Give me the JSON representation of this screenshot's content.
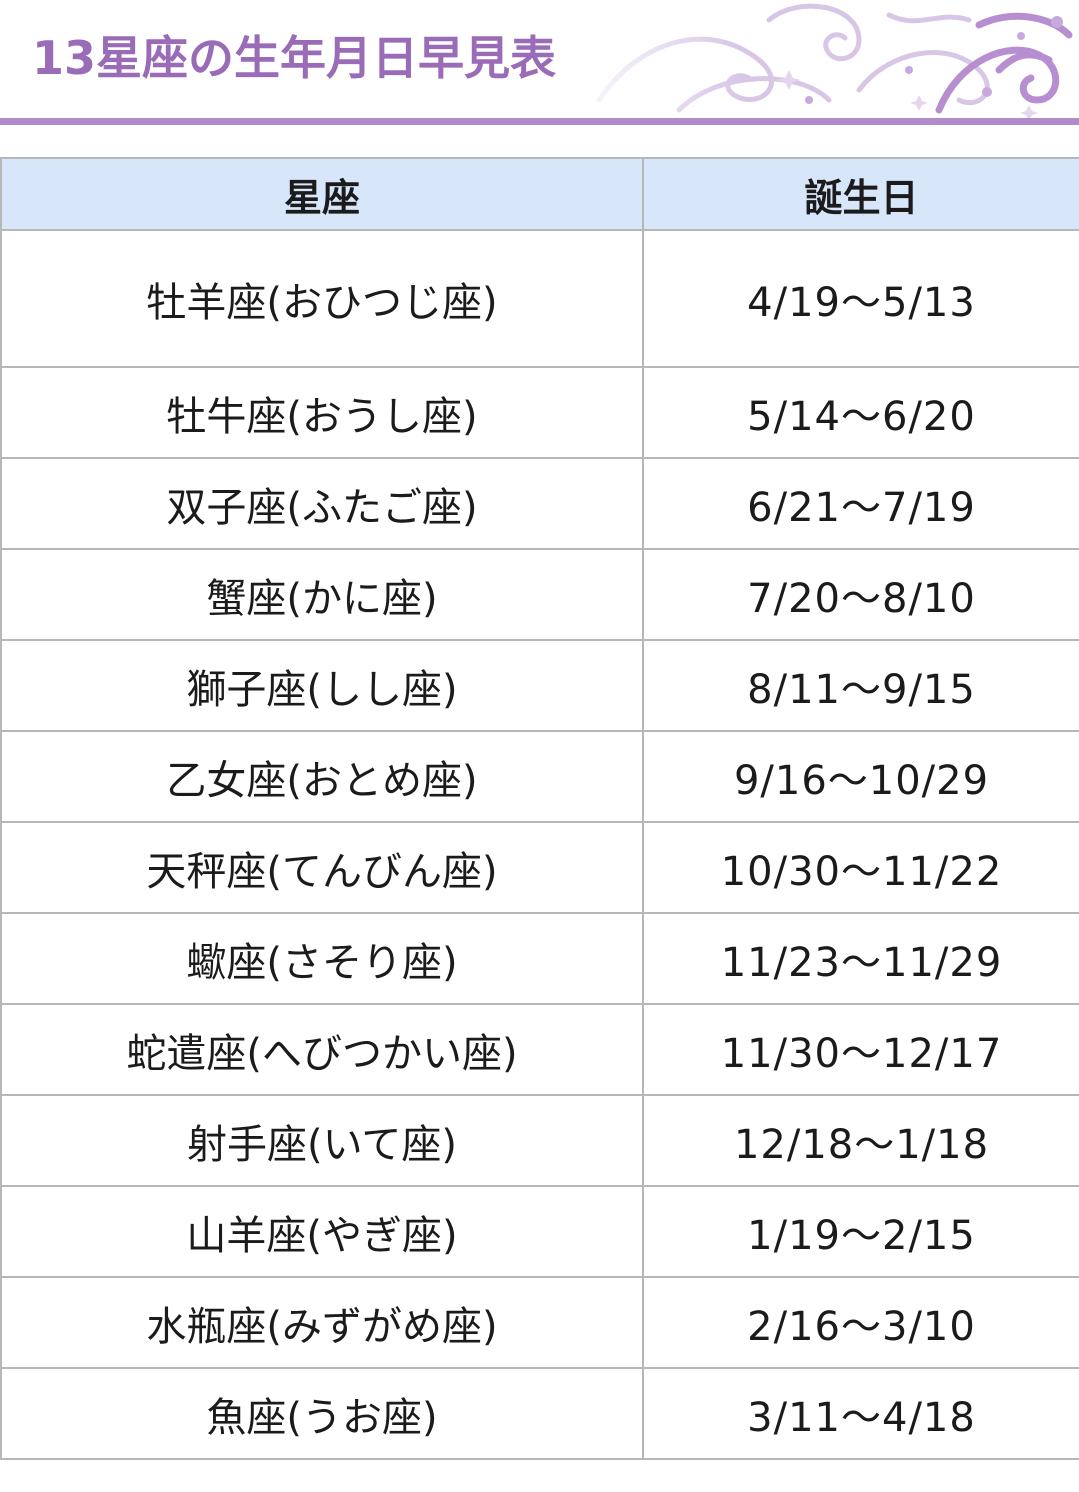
{
  "header": {
    "title": "13星座の生年月日早見表",
    "accent_color": "#9a6bb7",
    "ornament": "floral-swirl-ornament"
  },
  "table": {
    "columns": [
      "星座",
      "誕生日"
    ],
    "header_bg": "#d8e6fa",
    "rows": [
      {
        "sign": "牡羊座(おひつじ座)",
        "dates": "4/19〜5/13"
      },
      {
        "sign": "牡牛座(おうし座)",
        "dates": "5/14〜6/20"
      },
      {
        "sign": "双子座(ふたご座)",
        "dates": "6/21〜7/19"
      },
      {
        "sign": "蟹座(かに座)",
        "dates": "7/20〜8/10"
      },
      {
        "sign": "獅子座(しし座)",
        "dates": "8/11〜9/15"
      },
      {
        "sign": "乙女座(おとめ座)",
        "dates": "9/16〜10/29"
      },
      {
        "sign": "天秤座(てんびん座)",
        "dates": "10/30〜11/22"
      },
      {
        "sign": "蠍座(さそり座)",
        "dates": "11/23〜11/29"
      },
      {
        "sign": "蛇遣座(へびつかい座)",
        "dates": "11/30〜12/17"
      },
      {
        "sign": "射手座(いて座)",
        "dates": "12/18〜1/18"
      },
      {
        "sign": "山羊座(やぎ座)",
        "dates": "1/19〜2/15"
      },
      {
        "sign": "水瓶座(みずがめ座)",
        "dates": "2/16〜3/10"
      },
      {
        "sign": "魚座(うお座)",
        "dates": "3/11〜4/18"
      }
    ]
  }
}
